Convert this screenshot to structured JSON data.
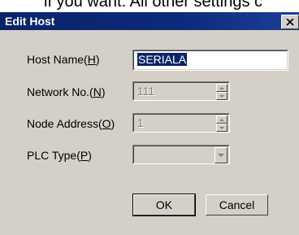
{
  "background_text": "if you want. All other settings c",
  "dialog": {
    "title": "Edit Host",
    "close_glyph": "×"
  },
  "fields": {
    "host_name": {
      "label_prefix": "Host Name(",
      "label_key": "H",
      "label_suffix": ")",
      "value": "SERIALA"
    },
    "network_no": {
      "label_prefix": "Network No.(",
      "label_key": "N",
      "label_suffix": ")",
      "value": "111"
    },
    "node_address": {
      "label_prefix": "Node Address(",
      "label_key": "O",
      "label_suffix": ")",
      "value": "1"
    },
    "plc_type": {
      "label_prefix": "PLC Type(",
      "label_key": "P",
      "label_suffix": ")",
      "value": ""
    }
  },
  "buttons": {
    "ok": "OK",
    "cancel": "Cancel"
  },
  "colors": {
    "titlebar": "#0a246a",
    "dialog_face": "#d4d0c8",
    "selection": "#0a246a"
  }
}
